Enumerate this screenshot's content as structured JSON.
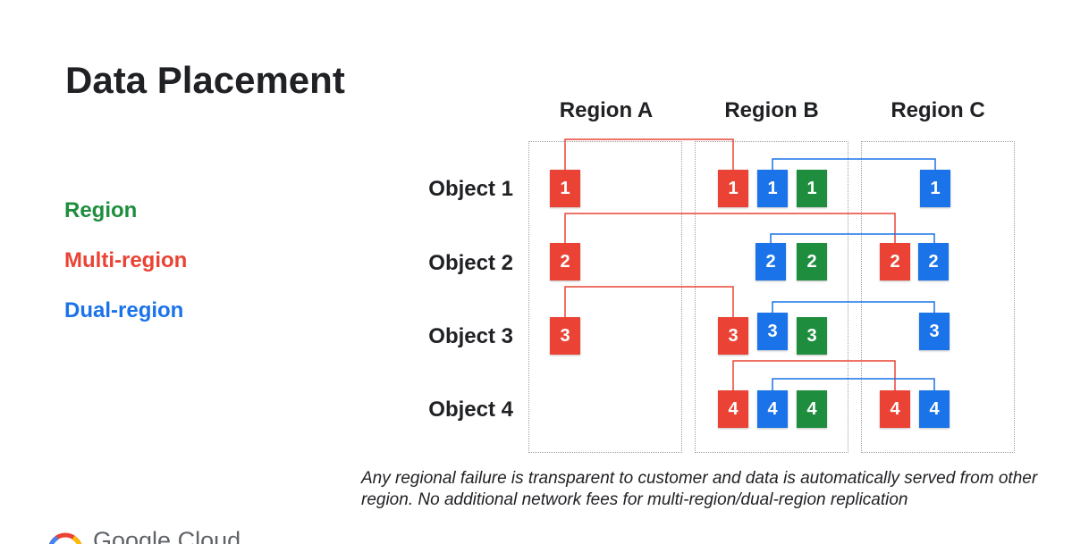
{
  "title": "Data Placement",
  "legend": {
    "region": "Region",
    "multi_region": "Multi-region",
    "dual_region": "Dual-region"
  },
  "colors": {
    "region": "#1e8e3e",
    "multi_region": "#ea4335",
    "dual_region": "#1a73e8",
    "connector_red": "#ea4335",
    "connector_blue": "#1a73e8"
  },
  "regions": [
    "Region A",
    "Region B",
    "Region C"
  ],
  "objects": [
    "Object 1",
    "Object 2",
    "Object 3",
    "Object 4"
  ],
  "placements": [
    {
      "object": "Object 1",
      "label": "1",
      "multi_region": [
        "Region A",
        "Region B"
      ],
      "dual_region": [
        "Region B",
        "Region C"
      ],
      "region": [
        "Region B"
      ]
    },
    {
      "object": "Object 2",
      "label": "2",
      "multi_region": [
        "Region A",
        "Region C"
      ],
      "dual_region": [
        "Region B",
        "Region C"
      ],
      "region": [
        "Region B"
      ]
    },
    {
      "object": "Object 3",
      "label": "3",
      "multi_region": [
        "Region A",
        "Region B"
      ],
      "dual_region": [
        "Region B",
        "Region C"
      ],
      "region": [
        "Region B"
      ]
    },
    {
      "object": "Object 4",
      "label": "4",
      "multi_region": [
        "Region B",
        "Region C"
      ],
      "dual_region": [
        "Region B",
        "Region C"
      ],
      "region": [
        "Region B"
      ]
    }
  ],
  "note": "Any regional failure is transparent to customer and data is automatically served from other region.  No additional network fees for multi-region/dual-region replication",
  "footer": {
    "brand": "Google Cloud",
    "logo_icon": "google-cloud-logo-icon"
  }
}
